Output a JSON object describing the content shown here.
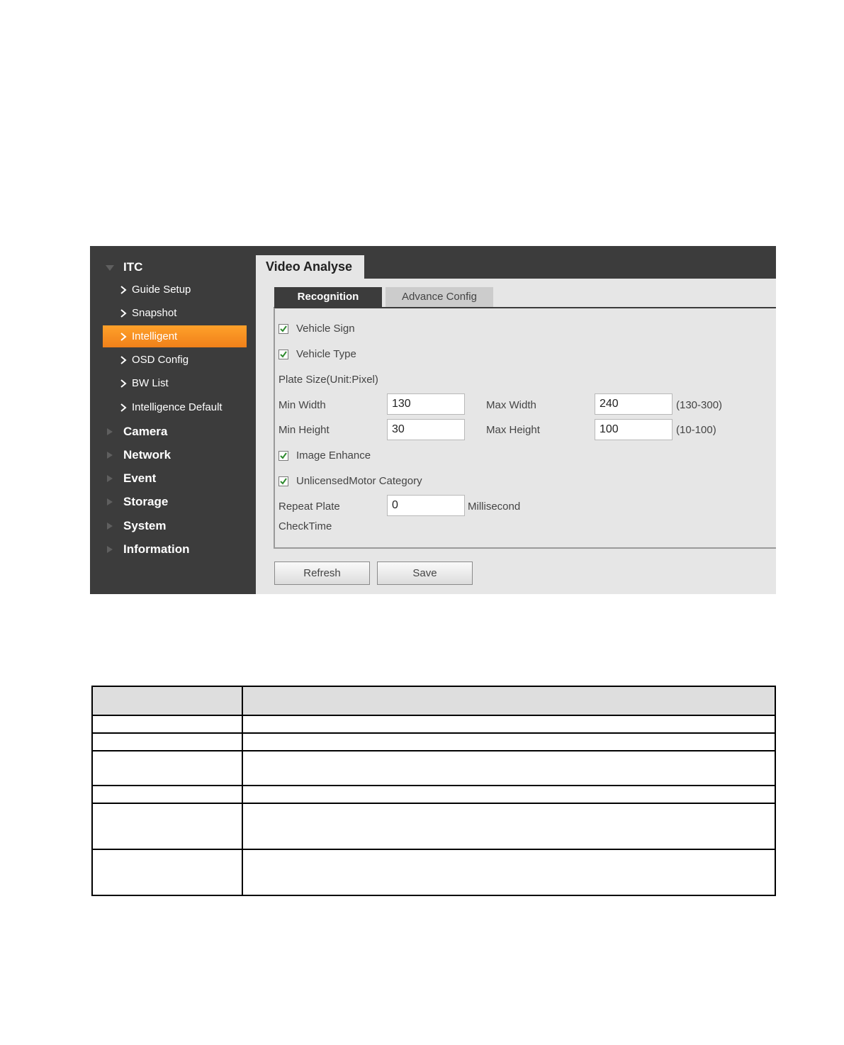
{
  "sidebar": {
    "itc": "ITC",
    "sub_items": [
      "Guide Setup",
      "Snapshot",
      "Intelligent",
      "OSD Config",
      "BW List",
      "Intelligence Default"
    ],
    "top_items": [
      "Camera",
      "Network",
      "Event",
      "Storage",
      "System",
      "Information"
    ]
  },
  "title": "Video Analyse",
  "tabs": {
    "recognition": "Recognition",
    "advance": "Advance Config"
  },
  "form": {
    "vehicle_sign": "Vehicle Sign",
    "vehicle_type": "Vehicle Type",
    "plate_size": "Plate Size(Unit:Pixel)",
    "min_width_label": "Min Width",
    "min_width": "130",
    "max_width_label": "Max Width",
    "max_width": "240",
    "width_range": "(130-300)",
    "min_height_label": "Min Height",
    "min_height": "30",
    "max_height_label": "Max Height",
    "max_height": "100",
    "height_range": "(10-100)",
    "image_enhance": "Image Enhance",
    "unlicensed": "UnlicensedMotor Category",
    "repeat_label_1": "Repeat Plate",
    "repeat_label_2": "CheckTime",
    "repeat_value": "0",
    "repeat_unit": "Millisecond"
  },
  "buttons": {
    "refresh": "Refresh",
    "save": "Save"
  },
  "colors": {
    "sidebar": "#3c3c3c",
    "active": "#f7901e",
    "panel": "#e6e6e6"
  }
}
